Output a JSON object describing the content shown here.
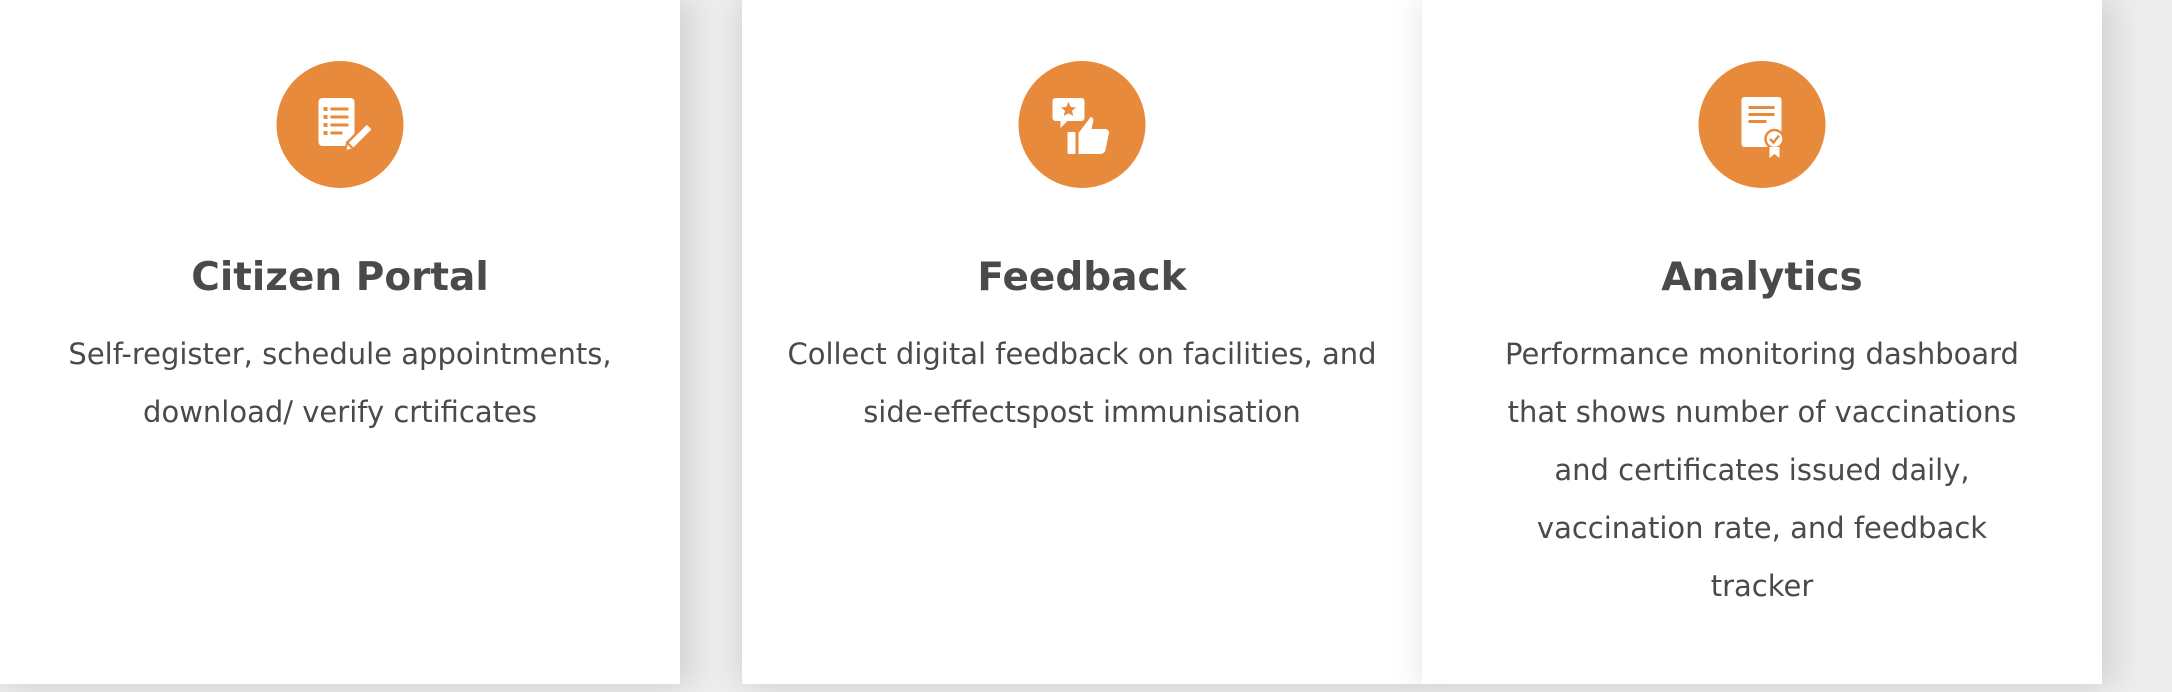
{
  "colors": {
    "accent": "#e88a3b",
    "text": "#4a4a4a",
    "card_bg": "#ffffff",
    "page_bg": "#ededed"
  },
  "cards": [
    {
      "icon": "document-edit-icon",
      "title": "Citizen Portal",
      "description": "Self-register, schedule appointments, download/ verify crtificates"
    },
    {
      "icon": "feedback-thumbs-up-icon",
      "title": "Feedback",
      "description": "Collect digital feedback on facilities, and side-effectspost immunisation"
    },
    {
      "icon": "certificate-icon",
      "title": "Analytics",
      "description": "Performance monitoring dashboard that shows number of vaccinations and certificates issued daily, vaccination rate, and feedback tracker"
    }
  ]
}
